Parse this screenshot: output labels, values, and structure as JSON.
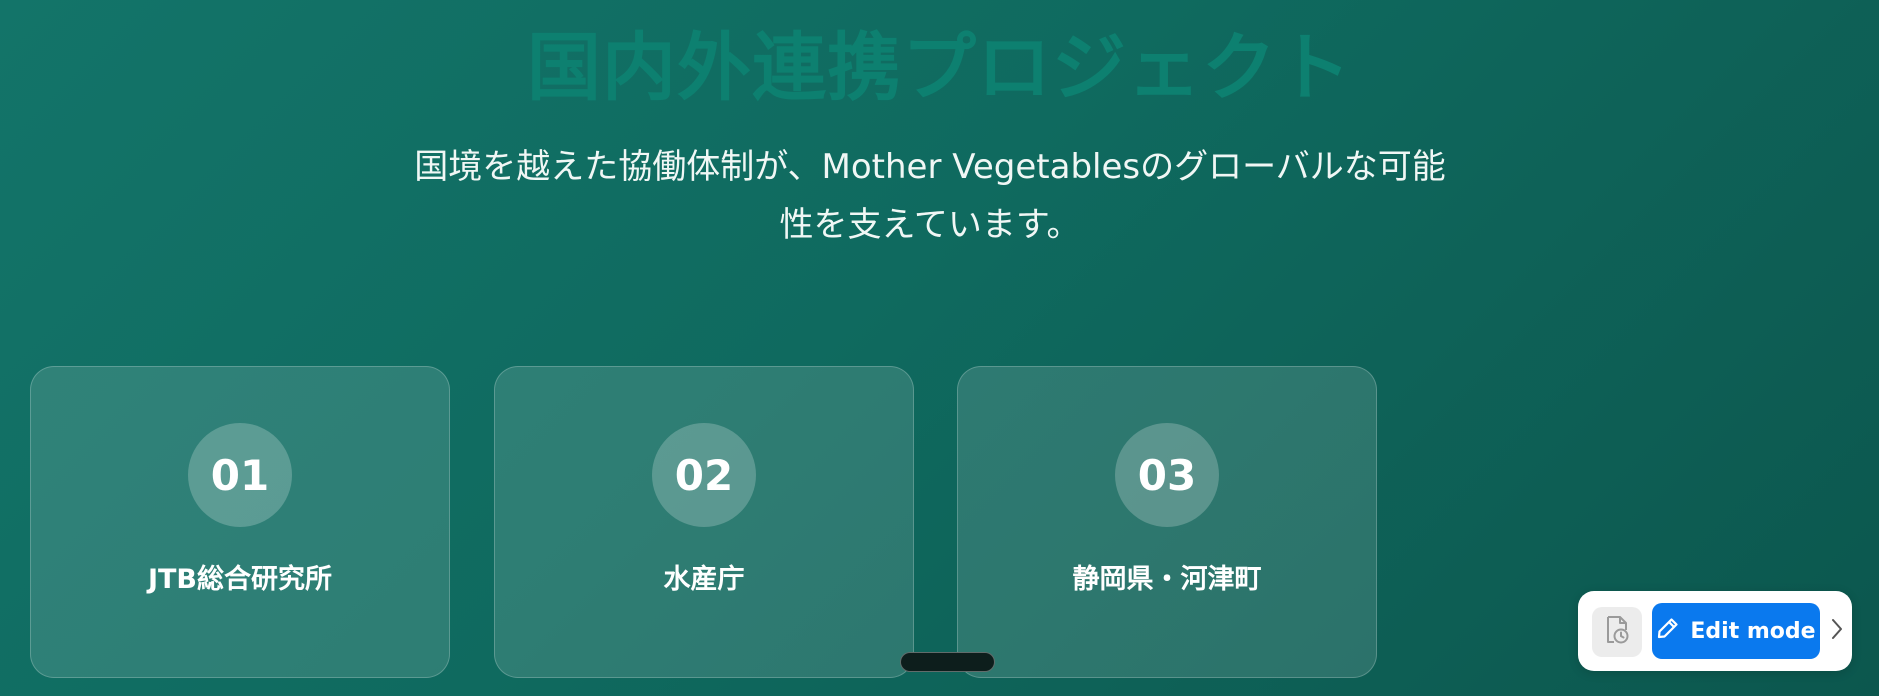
{
  "page": {
    "title": "国内外連携プロジェクト",
    "subtitle": "国境を越えた協働体制が、Mother Vegetablesのグローバルな可能性を支えています。"
  },
  "partners": [
    {
      "number": "01",
      "name": "JTB総合研究所"
    },
    {
      "number": "02",
      "name": "水産庁"
    },
    {
      "number": "03",
      "name": "静岡県・河津町"
    }
  ],
  "toolbar": {
    "history_icon": "file-history-icon",
    "edit_icon": "pencil-icon",
    "edit_label": "Edit mode",
    "chevron_icon": "chevron-right-icon"
  },
  "colors": {
    "background_start": "#137469",
    "background_end": "#0c574e",
    "title": "#0d8070",
    "edit_button": "#0a79ee"
  }
}
